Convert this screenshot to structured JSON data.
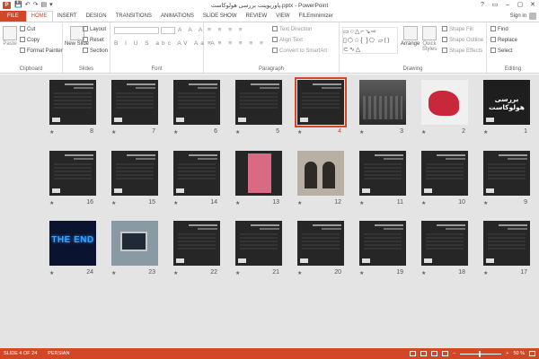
{
  "titlebar": {
    "logo": "P",
    "title": "پاورپوینت بررسی هولوکاست.pptx - PowerPoint",
    "qat": [
      "💾",
      "↶",
      "↷",
      "▤",
      "▾"
    ],
    "controls": [
      "?",
      "▭",
      "–",
      "▢",
      "✕"
    ]
  },
  "tabs": {
    "items": [
      "FILE",
      "HOME",
      "INSERT",
      "DESIGN",
      "TRANSITIONS",
      "ANIMATIONS",
      "SLIDE SHOW",
      "REVIEW",
      "VIEW",
      "FILEminimizer"
    ],
    "active": "HOME",
    "signin": "Sign in"
  },
  "ribbon": {
    "clipboard": {
      "label": "Clipboard",
      "paste": "Paste",
      "cut": "Cut",
      "copy": "Copy",
      "format_painter": "Format Painter"
    },
    "slides": {
      "label": "Slides",
      "new_slide": "New Slide",
      "layout": "Layout",
      "reset": "Reset",
      "section": "Section"
    },
    "font": {
      "label": "Font",
      "row1": "A A A",
      "row2": "B I U S abc AV Aa A"
    },
    "paragraph": {
      "label": "Paragraph",
      "text_direction": "Text Direction",
      "align_text": "Align Text",
      "convert_smartart": "Convert to SmartArt",
      "row1": "≡ ≡ ≡ ≡",
      "row2": "≡ ≡ ≡ ≡ ≡ ≡"
    },
    "drawing": {
      "label": "Drawing",
      "shapes": "▭○△⌐↘⇨\n▯⬡☆{ }⬠\n▱⟨⟩⊂∿△",
      "arrange": "Arrange",
      "quick_styles": "Quick Styles",
      "shape_fill": "Shape Fill",
      "shape_outline": "Shape Outline",
      "shape_effects": "Shape Effects"
    },
    "editing": {
      "label": "Editing",
      "find": "Find",
      "replace": "Replace",
      "select": "Select"
    }
  },
  "slides": [
    {
      "n": "1",
      "kind": "title",
      "title": "بررسی هولوکاست"
    },
    {
      "n": "2",
      "kind": "red"
    },
    {
      "n": "3",
      "kind": "photo"
    },
    {
      "n": "4",
      "kind": "text",
      "selected": true
    },
    {
      "n": "5",
      "kind": "text"
    },
    {
      "n": "6",
      "kind": "text"
    },
    {
      "n": "7",
      "kind": "text"
    },
    {
      "n": "8",
      "kind": "text"
    },
    {
      "n": "9",
      "kind": "text"
    },
    {
      "n": "10",
      "kind": "text"
    },
    {
      "n": "11",
      "kind": "text"
    },
    {
      "n": "12",
      "kind": "arch"
    },
    {
      "n": "13",
      "kind": "pink"
    },
    {
      "n": "14",
      "kind": "text"
    },
    {
      "n": "15",
      "kind": "text"
    },
    {
      "n": "16",
      "kind": "text"
    },
    {
      "n": "17",
      "kind": "text"
    },
    {
      "n": "18",
      "kind": "text"
    },
    {
      "n": "19",
      "kind": "text"
    },
    {
      "n": "20",
      "kind": "text"
    },
    {
      "n": "21",
      "kind": "text"
    },
    {
      "n": "22",
      "kind": "text"
    },
    {
      "n": "23",
      "kind": "laptop"
    },
    {
      "n": "24",
      "kind": "end",
      "title": "THE END"
    }
  ],
  "status": {
    "slide": "SLIDE 4 OF 24",
    "language": "PERSIAN",
    "zoom": "50 %",
    "zoom_minus": "–",
    "zoom_plus": "+"
  },
  "colors": {
    "accent": "#d24726",
    "sorter_bg": "#e4e4e4"
  }
}
